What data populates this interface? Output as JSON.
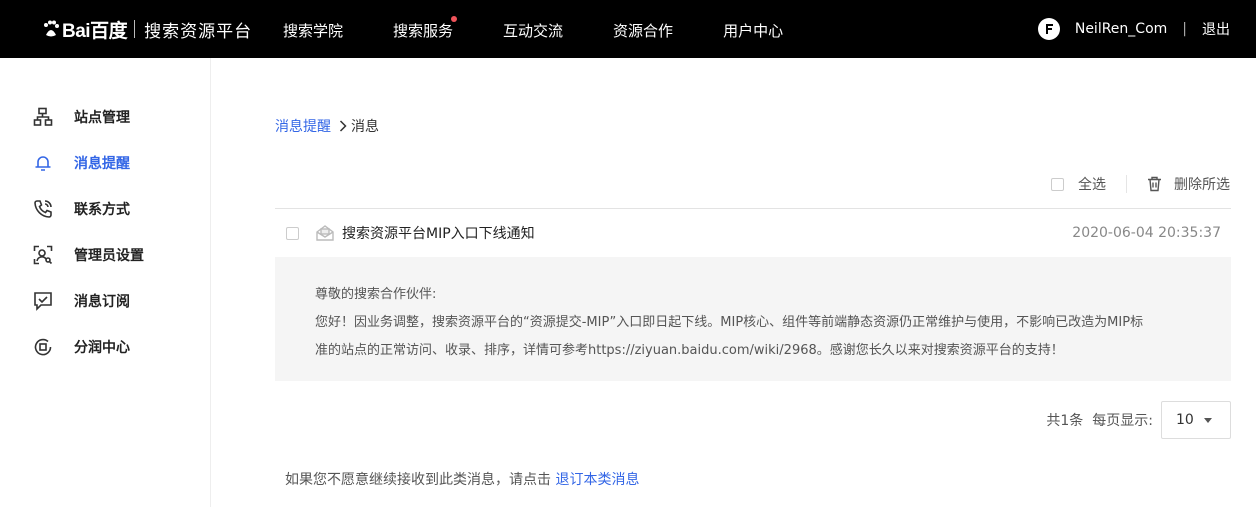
{
  "header": {
    "logo_brand": "Bai百度",
    "logo_title": "搜索资源平台",
    "nav": [
      "搜索学院",
      "搜索服务",
      "互动交流",
      "资源合作",
      "用户中心"
    ],
    "username": "NeilRen_Com",
    "separator": "|",
    "logout": "退出"
  },
  "sidebar": {
    "items": [
      {
        "label": "站点管理",
        "icon": "sitemap-icon"
      },
      {
        "label": "消息提醒",
        "icon": "bell-icon"
      },
      {
        "label": "联系方式",
        "icon": "phone-icon"
      },
      {
        "label": "管理员设置",
        "icon": "admin-user-icon"
      },
      {
        "label": "消息订阅",
        "icon": "subscribe-check-icon"
      },
      {
        "label": "分润中心",
        "icon": "revenue-share-icon"
      }
    ],
    "active_index": 1
  },
  "breadcrumb": {
    "parent": "消息提醒",
    "current": "消息"
  },
  "toolbar": {
    "select_all": "全选",
    "delete_selected": "删除所选"
  },
  "message": {
    "title": "搜索资源平台MIP入口下线通知",
    "time": "2020-06-04 20:35:37",
    "greeting": "尊敬的搜索合作伙伴:",
    "line1": "您好！因业务调整，搜索资源平台的“资源提交-MIP”入口即日起下线。MIP核心、组件等前端静态资源仍正常维护与使用，不影响已改造为MIP标",
    "line2": "准的站点的正常访问、收录、排序，详情可参考https://ziyuan.baidu.com/wiki/2968。感谢您长久以来对搜索资源平台的支持！"
  },
  "pager": {
    "total": "共1条",
    "per_page_label": "每页显示:",
    "per_page_value": "10"
  },
  "footer": {
    "text": "如果您不愿意继续接收到此类消息，请点击",
    "link": "退订本类消息"
  },
  "colors": {
    "topbar": "#000000",
    "accent": "#3366e6",
    "notify_dot": "#f0545b"
  }
}
